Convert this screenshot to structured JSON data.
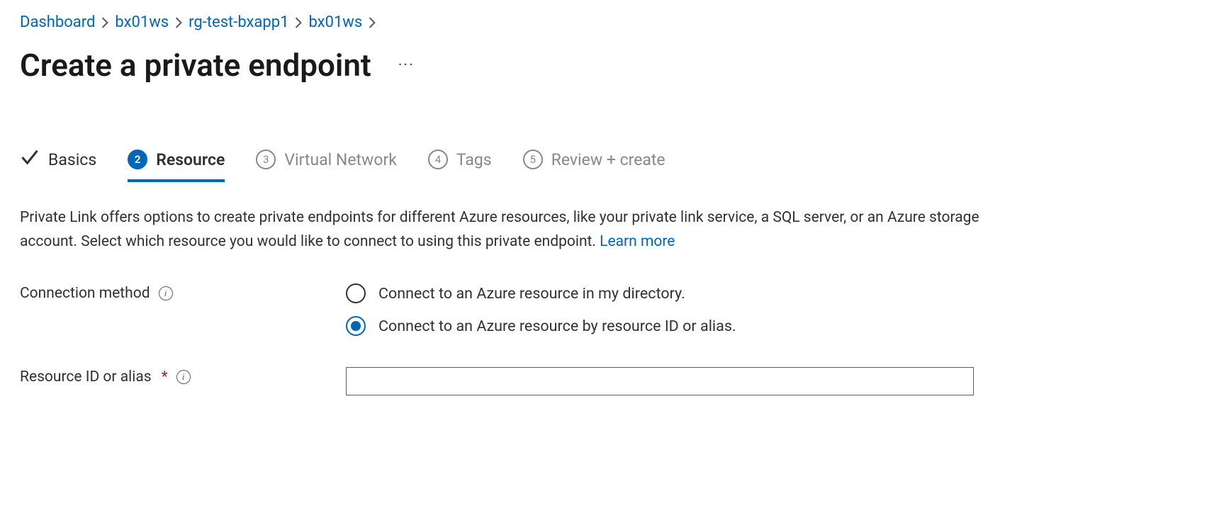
{
  "breadcrumb": {
    "items": [
      {
        "label": "Dashboard"
      },
      {
        "label": "bx01ws"
      },
      {
        "label": "rg-test-bxapp1"
      },
      {
        "label": "bx01ws"
      }
    ]
  },
  "title": "Create a private endpoint",
  "steps": {
    "s1": {
      "label": "Basics",
      "state": "done"
    },
    "s2": {
      "label": "Resource",
      "num": "2",
      "state": "active"
    },
    "s3": {
      "label": "Virtual Network",
      "num": "3",
      "state": "pending"
    },
    "s4": {
      "label": "Tags",
      "num": "4",
      "state": "pending"
    },
    "s5": {
      "label": "Review + create",
      "num": "5",
      "state": "pending"
    }
  },
  "description": {
    "text": "Private Link offers options to create private endpoints for different Azure resources, like your private link service, a SQL server, or an Azure storage account. Select which resource you would like to connect to using this private endpoint.  ",
    "learn_more": "Learn more"
  },
  "form": {
    "connection_method": {
      "label": "Connection method",
      "options": {
        "o1": {
          "label": "Connect to an Azure resource in my directory.",
          "selected": false
        },
        "o2": {
          "label": "Connect to an Azure resource by resource ID or alias.",
          "selected": true
        }
      }
    },
    "resource_id": {
      "label": "Resource ID or alias",
      "required_marker": "*",
      "value": ""
    }
  },
  "icons": {
    "info_glyph": "i"
  }
}
